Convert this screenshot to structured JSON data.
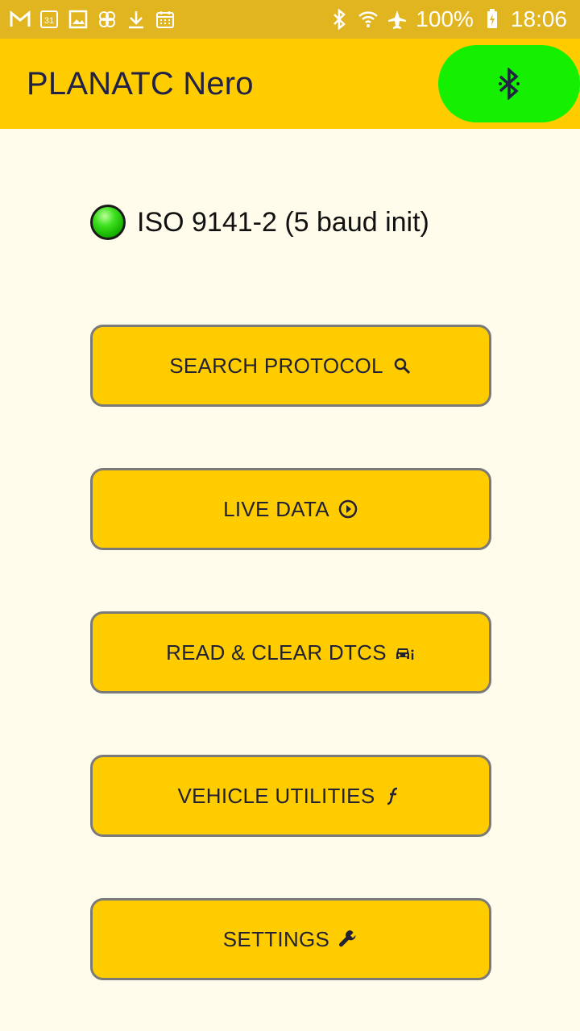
{
  "status_bar": {
    "battery": "100%",
    "time": "18:06",
    "icons": [
      "gmail-icon",
      "calendar-icon",
      "gallery-icon",
      "pinwheel-icon",
      "download-icon",
      "calendar-grid-icon",
      "bluetooth-icon",
      "wifi-icon",
      "airplane-icon",
      "battery-charging-icon"
    ],
    "calendar_day": "31"
  },
  "app_bar": {
    "title": "PLANATC Nero",
    "bluetooth_icon": "bluetooth-icon",
    "bluetooth_color": "#14F000"
  },
  "protocol": {
    "status_color": "#22CC00",
    "label": "ISO 9141-2 (5 baud init)"
  },
  "menu": [
    {
      "label": "SEARCH PROTOCOL",
      "icon": "search-icon"
    },
    {
      "label": "LIVE DATA",
      "icon": "play-circle-icon"
    },
    {
      "label": "READ & CLEAR DTCS",
      "icon": "car-info-icon"
    },
    {
      "label": "VEHICLE UTILITIES",
      "icon": "function-icon"
    },
    {
      "label": "SETTINGS",
      "icon": "wrench-icon"
    }
  ],
  "colors": {
    "accent": "#FFCC00",
    "status_bar": "#E0B51F",
    "background": "#FFFCEB"
  }
}
